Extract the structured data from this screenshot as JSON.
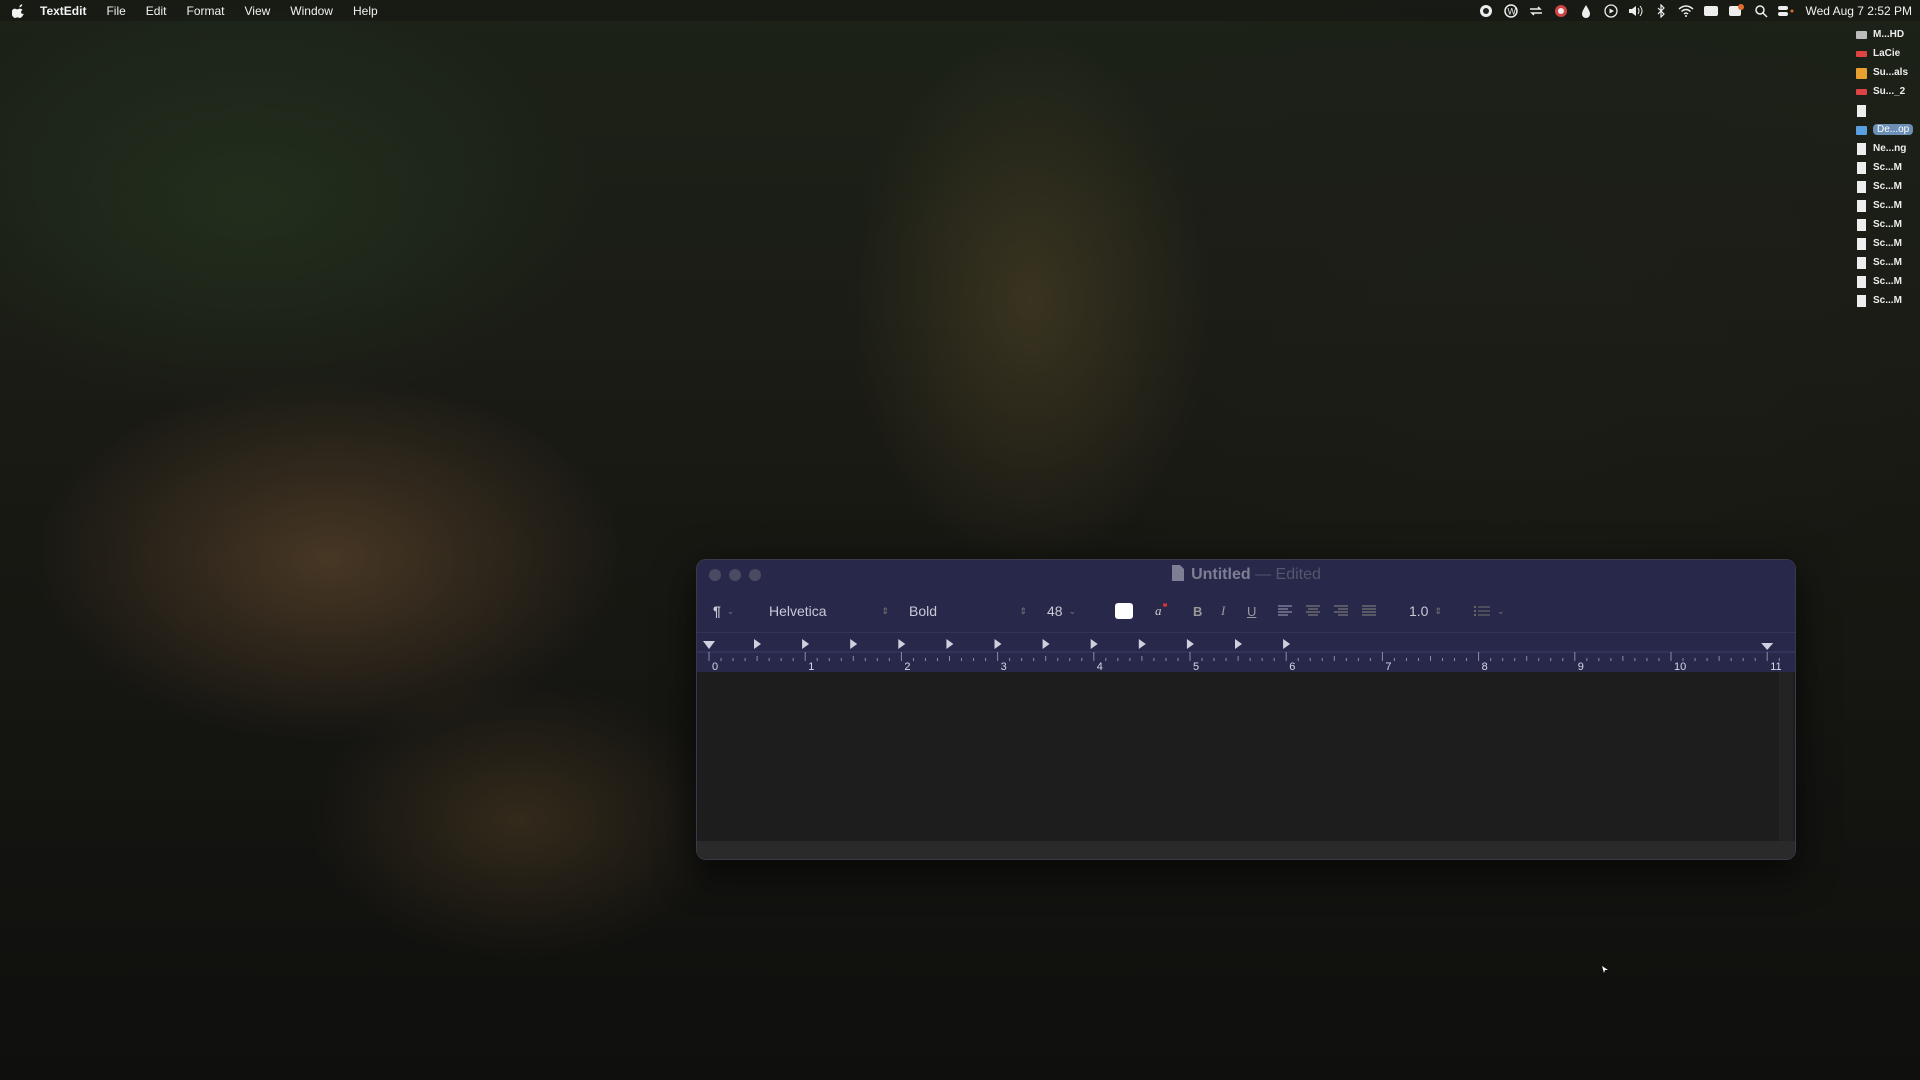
{
  "menubar": {
    "apple": "apple-logo",
    "items": [
      "TextEdit",
      "File",
      "Edit",
      "Format",
      "View",
      "Window",
      "Help"
    ],
    "clock": "Wed Aug 7  2:52 PM"
  },
  "desktop_icons": [
    {
      "label": "M...HD",
      "icon": "drive-icon"
    },
    {
      "label": "LaCie",
      "icon": "external-drive-icon"
    },
    {
      "label": "Su...als",
      "icon": "folder-icon"
    },
    {
      "label": "Su..._2",
      "icon": "external-drive-icon"
    },
    {
      "label": "",
      "icon": "document-icon"
    },
    {
      "label": "De...op",
      "icon": "folder-icon",
      "selected": true
    },
    {
      "label": "Ne...ng",
      "icon": "document-icon"
    },
    {
      "label": "Sc...M",
      "icon": "document-icon"
    },
    {
      "label": "Sc...M",
      "icon": "document-icon"
    },
    {
      "label": "Sc...M",
      "icon": "document-icon"
    },
    {
      "label": "Sc...M",
      "icon": "document-icon"
    },
    {
      "label": "Sc...M",
      "icon": "document-icon"
    },
    {
      "label": "Sc...M",
      "icon": "document-icon"
    },
    {
      "label": "Sc...M",
      "icon": "document-icon"
    },
    {
      "label": "Sc...M",
      "icon": "document-icon"
    }
  ],
  "window": {
    "title": "Untitled",
    "separator": "—",
    "status": "Edited",
    "toolbar": {
      "paragraph_style": "¶",
      "font_family": "Helvetica",
      "font_style": "Bold",
      "font_size": "48",
      "text_color": "#ffffff",
      "bold": "B",
      "italic": "I",
      "underline": "U",
      "line_spacing": "1.0"
    },
    "ruler_labels": [
      "0",
      "1",
      "2",
      "3",
      "4",
      "5",
      "6",
      "7",
      "8",
      "9",
      "10",
      "11"
    ]
  }
}
